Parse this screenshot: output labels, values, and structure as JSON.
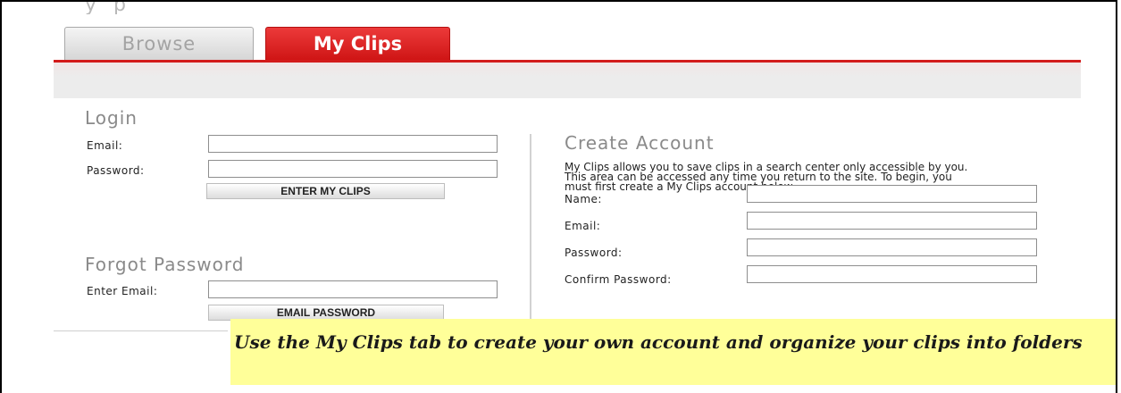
{
  "tabs": {
    "browse": "Browse",
    "my_clips": "My Clips"
  },
  "login": {
    "title": "Login",
    "email_label": "Email:",
    "password_label": "Password:",
    "submit_label": "ENTER MY CLIPS",
    "email_value": "",
    "password_value": ""
  },
  "forgot": {
    "title": "Forgot Password",
    "email_label": "Enter Email:",
    "submit_label": "EMAIL PASSWORD",
    "email_value": ""
  },
  "create": {
    "title": "Create Account",
    "description": "My Clips allows you to save clips in a search center only accessible by you. This area can be accessed any time you return to the site. To begin, you must first create a My Clips account below.",
    "name_label": "Name:",
    "email_label": "Email:",
    "password_label": "Password:",
    "confirm_label": "Confirm Password:"
  },
  "callout": {
    "text": "Use the My Clips tab to create your own account and organize your clips into folders"
  },
  "colors": {
    "active_tab": "#d31a1a",
    "callout_bg": "#ffff99"
  }
}
